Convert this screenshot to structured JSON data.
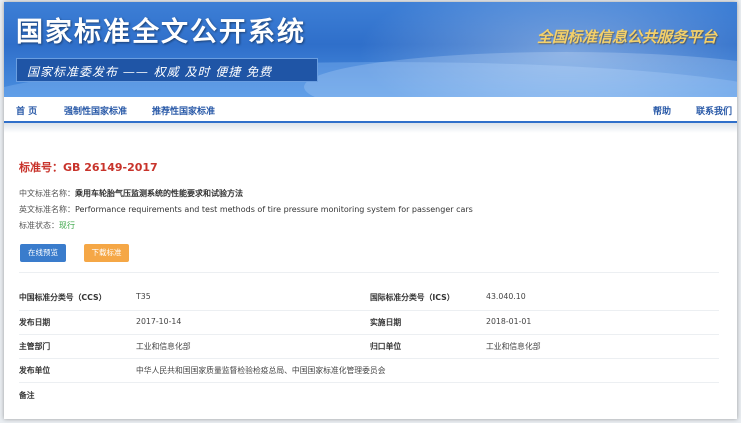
{
  "header": {
    "site_title": "国家标准全文公开系统",
    "slogan": "国家标准委发布 —— 权威 及时 便捷 免费",
    "platform": "全国标准信息公共服务平台"
  },
  "nav": {
    "home": "首 页",
    "mandatory": "强制性国家标准",
    "recommended": "推荐性国家标准",
    "help": "帮助",
    "contact": "联系我们"
  },
  "standard": {
    "number_label": "标准号：GB 26149-2017",
    "cn_name_label": "中文标准名称：",
    "cn_name": "乘用车轮胎气压监测系统的性能要求和试验方法",
    "en_name_label": "英文标准名称：",
    "en_name": "Performance requirements and test methods of tire pressure monitoring system for passenger cars",
    "status_label": "标准状态：",
    "status": "现行"
  },
  "buttons": {
    "preview": "在线预览",
    "download": "下载标准"
  },
  "details": {
    "ccs_label": "中国标准分类号（CCS）",
    "ccs": "T35",
    "ics_label": "国际标准分类号（ICS）",
    "ics": "43.040.10",
    "publish_date_label": "发布日期",
    "publish_date": "2017-10-14",
    "effective_date_label": "实施日期",
    "effective_date": "2018-01-01",
    "authority_label": "主管部门",
    "authority": "工业和信息化部",
    "responsible_label": "归口单位",
    "responsible": "工业和信息化部",
    "issuer_label": "发布单位",
    "issuer": "中华人民共和国国家质量监督检验检疫总局、中国国家标准化管理委员会",
    "remarks_label": "备注"
  },
  "colors": {
    "banner_blue": "#2f6fca",
    "standard_red": "#c8332b",
    "preview_button": "#3a7ccc",
    "download_button": "#f5a746",
    "status_green": "#3aa646"
  }
}
